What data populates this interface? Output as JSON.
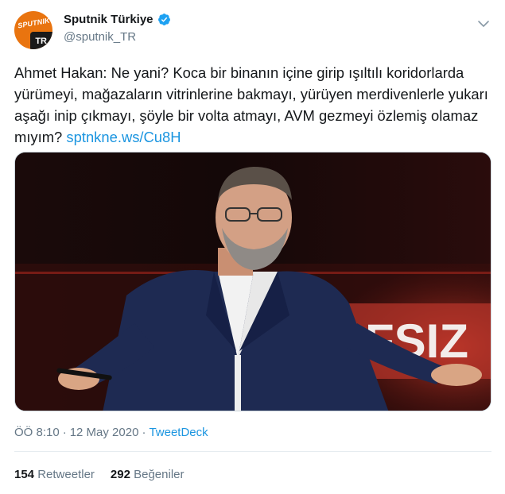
{
  "account": {
    "display_name": "Sputnik Türkiye",
    "handle": "@sputnik_TR",
    "verified": true,
    "avatar_brand": "SPUTNIK",
    "avatar_tag": "TR"
  },
  "tweet": {
    "text": "Ahmet Hakan: Ne yani? Koca bir binanın içine girip ışıltılı koridorlarda yürümeyi, mağazaların vitrinlerine bakmayı, yürüyen merdivenlerle yukarı aşağı inip çıkmayı, şöyle bir volta atmayı, AVM gezmeyi özlemiş olamaz mıyım?",
    "link": "sptnkne.ws/Cu8H"
  },
  "media": {
    "overlay_text": "FSIZ"
  },
  "meta": {
    "time": "ÖÖ 8:10",
    "separator": "·",
    "date": "12 May 2020",
    "source": "TweetDeck"
  },
  "stats": {
    "retweets_count": "154",
    "retweets_label": "Retweetler",
    "likes_count": "292",
    "likes_label": "Beğeniler"
  },
  "colors": {
    "link": "#1b95e0",
    "muted": "#657786",
    "text": "#14171a",
    "verified": "#1da1f2",
    "brand_orange": "#e9740f"
  },
  "icons": {
    "verified": "verified-badge-icon",
    "caret": "chevron-down-icon"
  }
}
